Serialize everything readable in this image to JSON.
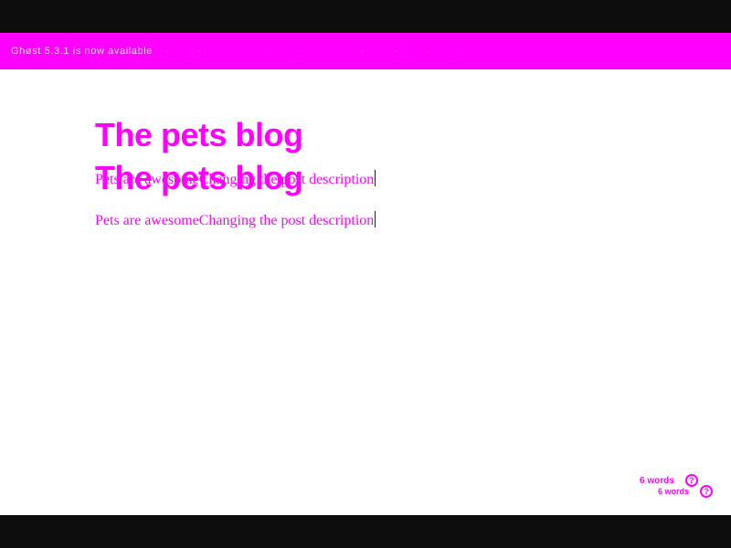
{
  "notice": {
    "text": "Ghøst 5.3.1 is now available",
    "faint_items": [
      "·",
      "·",
      "·",
      "·",
      "·",
      "·",
      "·",
      "·",
      "·",
      "·"
    ]
  },
  "post": {
    "title": "The pets blog",
    "title_ghost": "The pets blog",
    "description": "Pets are awesomeChanging the post description",
    "description_ghost": "Pets are awesomeChanging the post description"
  },
  "footer": {
    "word_count_a": "6 words",
    "word_count_b": "6 words",
    "help_icon": "?"
  },
  "colors": {
    "accent": "#ff00ff",
    "bar": "#0d0d0d",
    "background": "#ffffff"
  },
  "icons": {
    "help": "help-circle-icon"
  }
}
